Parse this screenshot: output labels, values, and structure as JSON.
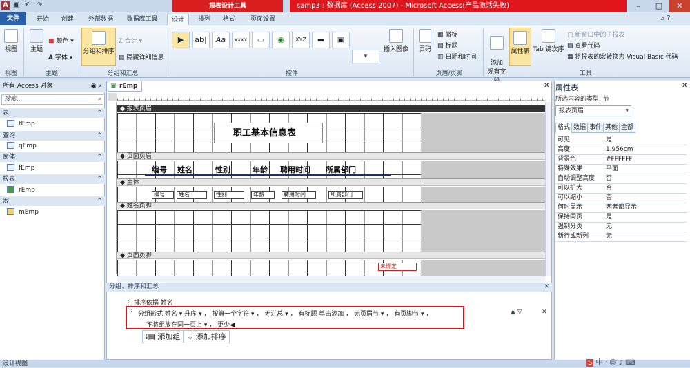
{
  "app": {
    "title": "samp3 : 数据库 (Access 2007) - Microsoft Access(产品激活失败)",
    "context_tool": "报表设计工具"
  },
  "tabs": [
    "文件",
    "开始",
    "创建",
    "外部数据",
    "数据库工具",
    "设计",
    "排列",
    "格式",
    "页面设置"
  ],
  "ribbon": {
    "groups": [
      "视图",
      "主题",
      "分组和汇总",
      "控件",
      "页眉/页脚",
      "工具"
    ],
    "view_btn": "视图",
    "theme_btn": "主题",
    "colors_btn": "颜色",
    "fonts_btn": "字体",
    "group_sort_btn": "分组和排序",
    "totals_btn": "合计",
    "hide_details_btn": "隐藏详细信息",
    "insert_image_btn": "插入图像",
    "page_num_btn": "页码",
    "logo_btn": "徽标",
    "title_btn": "标题",
    "datetime_btn": "日期和时间",
    "add_fields_btn": "添加\n现有字段",
    "property_sheet_btn": "属性表",
    "tab_order_btn": "Tab 键次序",
    "subform_btn": "新窗口中的子报表",
    "view_code_btn": "查看代码",
    "macro_vba_btn": "将报表的宏转换为 Visual Basic 代码",
    "controls": [
      "▶",
      "ab|",
      "Aa",
      "xxxx",
      "▭",
      "◉",
      "XYZ",
      "▬",
      "▣"
    ]
  },
  "nav": {
    "header": "所有 Access 对象",
    "search_placeholder": "搜索...",
    "categories": [
      {
        "label": "表",
        "items": [
          "tEmp"
        ]
      },
      {
        "label": "查询",
        "items": [
          "qEmp"
        ]
      },
      {
        "label": "窗体",
        "items": [
          "fEmp"
        ]
      },
      {
        "label": "报表",
        "items": [
          "rEmp"
        ]
      },
      {
        "label": "宏",
        "items": [
          "mEmp"
        ]
      }
    ]
  },
  "doc": {
    "tab": "rEmp",
    "sections": {
      "report_header": "报表页眉",
      "page_header": "页面页眉",
      "detail": "主体",
      "group_footer": "姓名页脚",
      "page_footer": "页面页脚"
    },
    "report_title": "职工基本信息表",
    "header_labels": [
      "编号",
      "姓名",
      "性别",
      "年龄",
      "聘用时间",
      "所属部门"
    ],
    "detail_fields": [
      "编号",
      "姓名",
      "性别",
      "年龄",
      "聘用时间",
      "所属部门"
    ],
    "unbound": "未绑定"
  },
  "group_sort": {
    "panel_title": "分组、排序和汇总",
    "sort_line": "排序依据 姓名",
    "group_line": "分组形式 姓名 ▾  升序 ▾ ， 按第一个字符 ▾ ， 无汇总 ▾ ， 有标题 单击添加 ， 无页眉节 ▾ ， 有页脚节 ▾ ，",
    "group_line2": "不将组放在同一页上 ▾ ， 更少◀",
    "add_group": "添加组",
    "add_sort": "添加排序"
  },
  "props": {
    "title": "属性表",
    "subtitle": "所选内容的类型: 节",
    "selected": "报表页眉",
    "tabs": [
      "格式",
      "数据",
      "事件",
      "其他",
      "全部"
    ],
    "rows": [
      [
        "可见",
        "是"
      ],
      [
        "高度",
        "1.956cm"
      ],
      [
        "背景色",
        "#FFFFFF"
      ],
      [
        "特殊效果",
        "平面"
      ],
      [
        "自动调整高度",
        "否"
      ],
      [
        "可以扩大",
        "否"
      ],
      [
        "可以缩小",
        "否"
      ],
      [
        "何时显示",
        "两者都显示"
      ],
      [
        "保持同页",
        "是"
      ],
      [
        "强制分页",
        "无"
      ],
      [
        "新行或新列",
        "无"
      ]
    ]
  },
  "status": "设计视图",
  "colors": {
    "accent": "#2a5ea8",
    "ctx": "#d81e1e",
    "highlight": "#d4121b"
  }
}
